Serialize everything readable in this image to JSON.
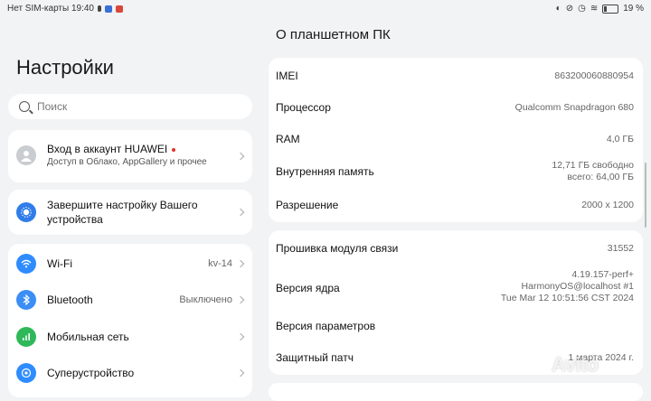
{
  "status_bar": {
    "left_text": "Нет SIM-карты 19:40",
    "battery": "19 %"
  },
  "settings": {
    "title": "Настройки",
    "search_placeholder": "Поиск",
    "account": {
      "title": "Вход в аккаунт HUAWEI",
      "subtitle": "Доступ в Облако, AppGallery и прочее"
    },
    "setup": {
      "line1": "Завершите настройку Вашего",
      "line2": "устройства"
    },
    "items": [
      {
        "label": "Wi-Fi",
        "value": "kv-14",
        "icon": "wifi-icon",
        "color": "#2f8cff"
      },
      {
        "label": "Bluetooth",
        "value": "Выключено",
        "icon": "bluetooth-icon",
        "color": "#3a8ef6"
      },
      {
        "label": "Мобильная сеть",
        "value": "",
        "icon": "mobile-network-icon",
        "color": "#2fb85a"
      },
      {
        "label": "Суперустройство",
        "value": "",
        "icon": "superdevice-icon",
        "color": "#2f8cff"
      }
    ]
  },
  "about": {
    "title": "О планшетном ПК",
    "card1": [
      {
        "label": "IMEI",
        "value": "863200060880954"
      },
      {
        "label": "Процессор",
        "value": "Qualcomm Snapdragon 680"
      },
      {
        "label": "RAM",
        "value": "4,0  ГБ"
      },
      {
        "label": "Внутренняя память",
        "value_line1": "12,71  ГБ свободно",
        "value_line2": "всего: 64,00  ГБ"
      },
      {
        "label": "Разрешение",
        "value": "2000 x 1200"
      }
    ],
    "card2": [
      {
        "label": "Прошивка модуля связи",
        "value": "31552"
      },
      {
        "label": "Версия ядра",
        "value_line1": "4.19.157-perf+",
        "value_line2": "HarmonyOS@localhost #1",
        "value_line3": "Tue Mar 12 10:51:56 CST 2024"
      },
      {
        "label": "Версия параметров",
        "value": ""
      },
      {
        "label": "Защитный патч",
        "value": "1 марта 2024 г."
      }
    ]
  },
  "watermark": "Avito"
}
